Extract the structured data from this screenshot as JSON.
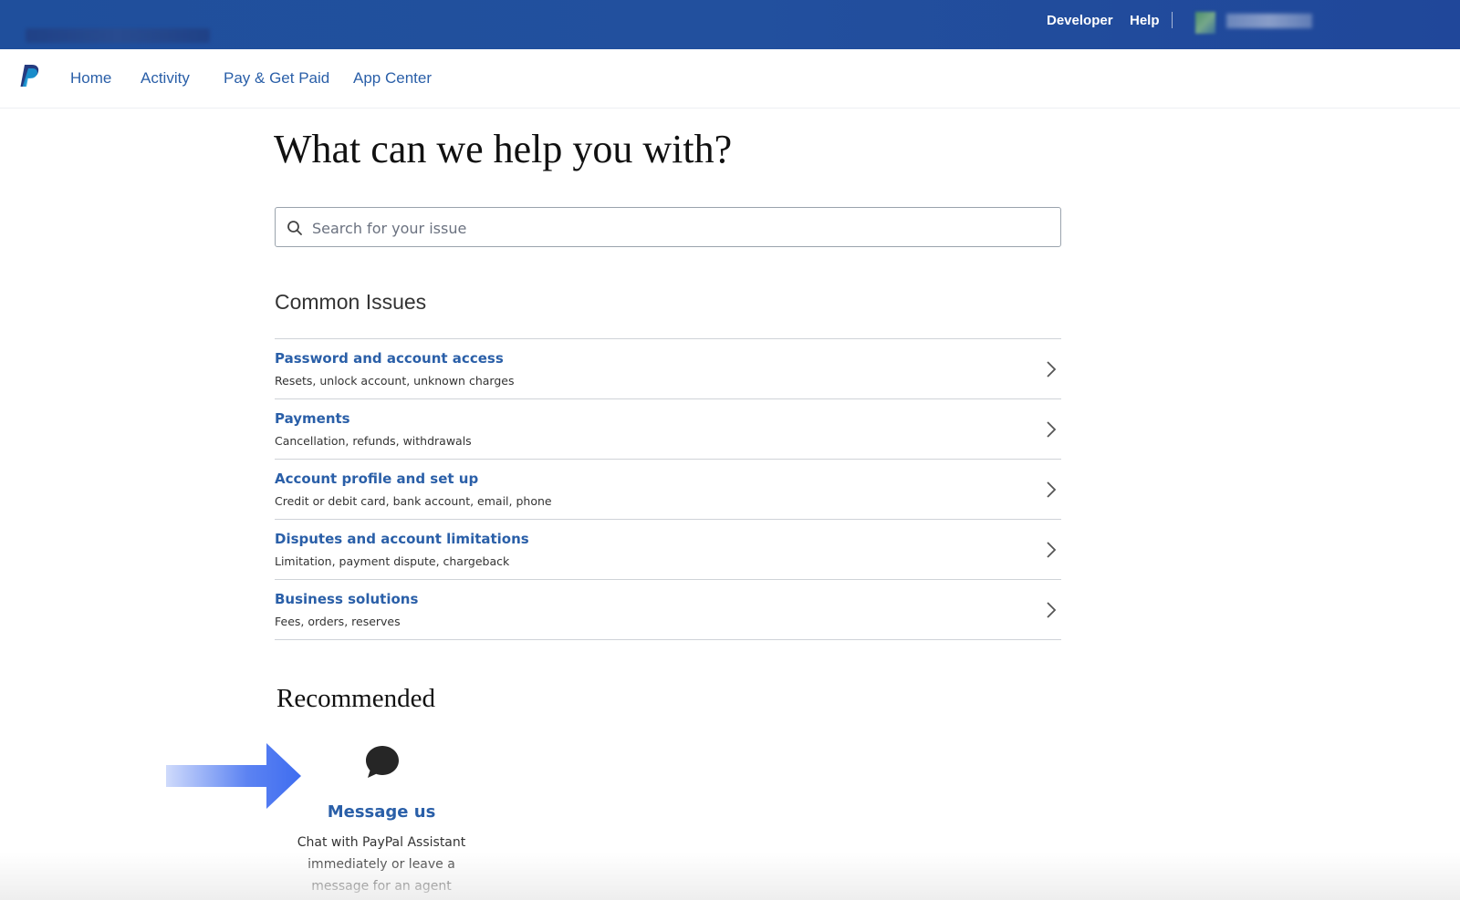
{
  "header": {
    "links": [
      {
        "label": "Developer"
      },
      {
        "label": "Help"
      }
    ]
  },
  "nav": {
    "items": [
      {
        "label": "Home"
      },
      {
        "label": "Activity"
      },
      {
        "label": "Pay & Get Paid"
      },
      {
        "label": "App Center"
      }
    ]
  },
  "main": {
    "heading": "What can we help you with?",
    "search": {
      "placeholder": "Search for your issue"
    },
    "common_issues": {
      "title": "Common Issues",
      "items": [
        {
          "title": "Password and account access",
          "desc": "Resets, unlock account, unknown charges"
        },
        {
          "title": "Payments",
          "desc": "Cancellation, refunds, withdrawals"
        },
        {
          "title": "Account profile and set up",
          "desc": "Credit or debit card, bank account, email, phone"
        },
        {
          "title": "Disputes and account limitations",
          "desc": "Limitation, payment dispute, chargeback"
        },
        {
          "title": "Business solutions",
          "desc": "Fees, orders, reserves"
        }
      ]
    },
    "recommended": {
      "title": "Recommended",
      "message_us": {
        "label": "Message us",
        "desc": "Chat with PayPal Assistant immediately or leave a message for an agent"
      }
    }
  },
  "icons": {
    "logo": "paypal-logo-icon",
    "search": "search-icon",
    "chevron": "chevron-right-icon",
    "chat": "chat-bubble-icon",
    "annotation": "arrow-right-icon"
  },
  "colors": {
    "topbar": "#22509e",
    "link": "#2a5fa8",
    "arrow": "#3f6df0"
  }
}
